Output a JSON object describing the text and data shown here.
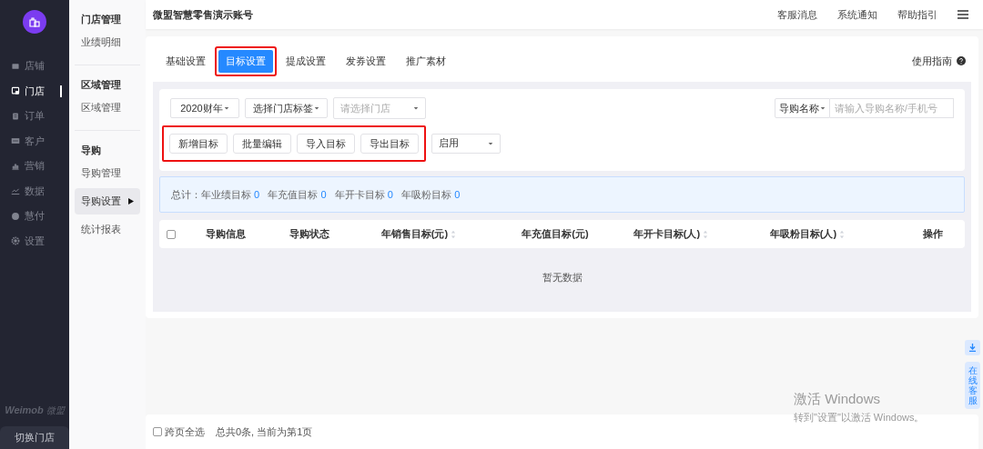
{
  "sidebar": {
    "items": [
      {
        "kind": "store",
        "label": "店铺",
        "selected": false
      },
      {
        "kind": "shop",
        "label": "门店",
        "selected": true
      },
      {
        "kind": "order",
        "label": "订单",
        "selected": false
      },
      {
        "kind": "customer",
        "label": "客户",
        "selected": false
      },
      {
        "kind": "marketing",
        "label": "营销",
        "selected": false
      },
      {
        "kind": "data",
        "label": "数据",
        "selected": false
      },
      {
        "kind": "pay",
        "label": "慧付",
        "selected": false
      },
      {
        "kind": "settings",
        "label": "设置",
        "selected": false
      }
    ],
    "brand": {
      "name": "Weimob",
      "suffix": "微盟"
    },
    "switch_button": "切换门店"
  },
  "subnav": {
    "sections": [
      {
        "title": "门店管理",
        "items": [
          {
            "label": "业绩明细",
            "selected": false
          }
        ]
      },
      {
        "title": "区域管理",
        "items": [
          {
            "label": "区域管理",
            "selected": false
          }
        ]
      },
      {
        "title": "导购",
        "items": [
          {
            "label": "导购管理",
            "selected": false
          },
          {
            "label": "导购设置",
            "selected": true
          },
          {
            "label": "统计报表",
            "selected": false
          }
        ]
      }
    ]
  },
  "header": {
    "account": "微盟智慧零售演示账号",
    "links": [
      "客服消息",
      "系统通知",
      "帮助指引"
    ]
  },
  "tabs": [
    {
      "label": "基础设置",
      "selected": false,
      "annotated": false
    },
    {
      "label": "目标设置",
      "selected": true,
      "annotated": true
    },
    {
      "label": "提成设置",
      "selected": false,
      "annotated": false
    },
    {
      "label": "发券设置",
      "selected": false,
      "annotated": false
    },
    {
      "label": "推广素材",
      "selected": false,
      "annotated": false
    }
  ],
  "guide_link": "使用指南",
  "filters": {
    "year": "2020财年",
    "store_tag": "选择门店标签",
    "store_placeholder": "请选择门店",
    "search_type": "导购名称",
    "search_placeholder": "请输入导购名称/手机号",
    "status": "启用"
  },
  "actions": {
    "annotated": true,
    "buttons": [
      "新增目标",
      "批量编辑",
      "导入目标",
      "导出目标"
    ]
  },
  "summary": {
    "label": "总计：",
    "items": [
      {
        "label": "年业绩目标",
        "value": "0"
      },
      {
        "label": "年充值目标",
        "value": "0"
      },
      {
        "label": "年开卡目标",
        "value": "0"
      },
      {
        "label": "年吸粉目标",
        "value": "0"
      }
    ]
  },
  "table": {
    "select_all_checked": false,
    "columns": [
      {
        "label": "导购信息",
        "sortable": false
      },
      {
        "label": "导购状态",
        "sortable": false
      },
      {
        "label": "年销售目标(元)",
        "sortable": true
      },
      {
        "label": "年充值目标(元)",
        "sortable": false
      },
      {
        "label": "年开卡目标(人)",
        "sortable": true
      },
      {
        "label": "年吸粉目标(人)",
        "sortable": true
      },
      {
        "label": "操作",
        "sortable": false
      }
    ],
    "empty_text": "暂无数据"
  },
  "footer": {
    "cross_page_label": "跨页全选",
    "cross_page_checked": false,
    "info": "总共0条, 当前为第1页"
  },
  "float_service": "在线客服",
  "windows_activation": {
    "title": "激活 Windows",
    "hint": "转到\"设置\"以激活 Windows。"
  }
}
